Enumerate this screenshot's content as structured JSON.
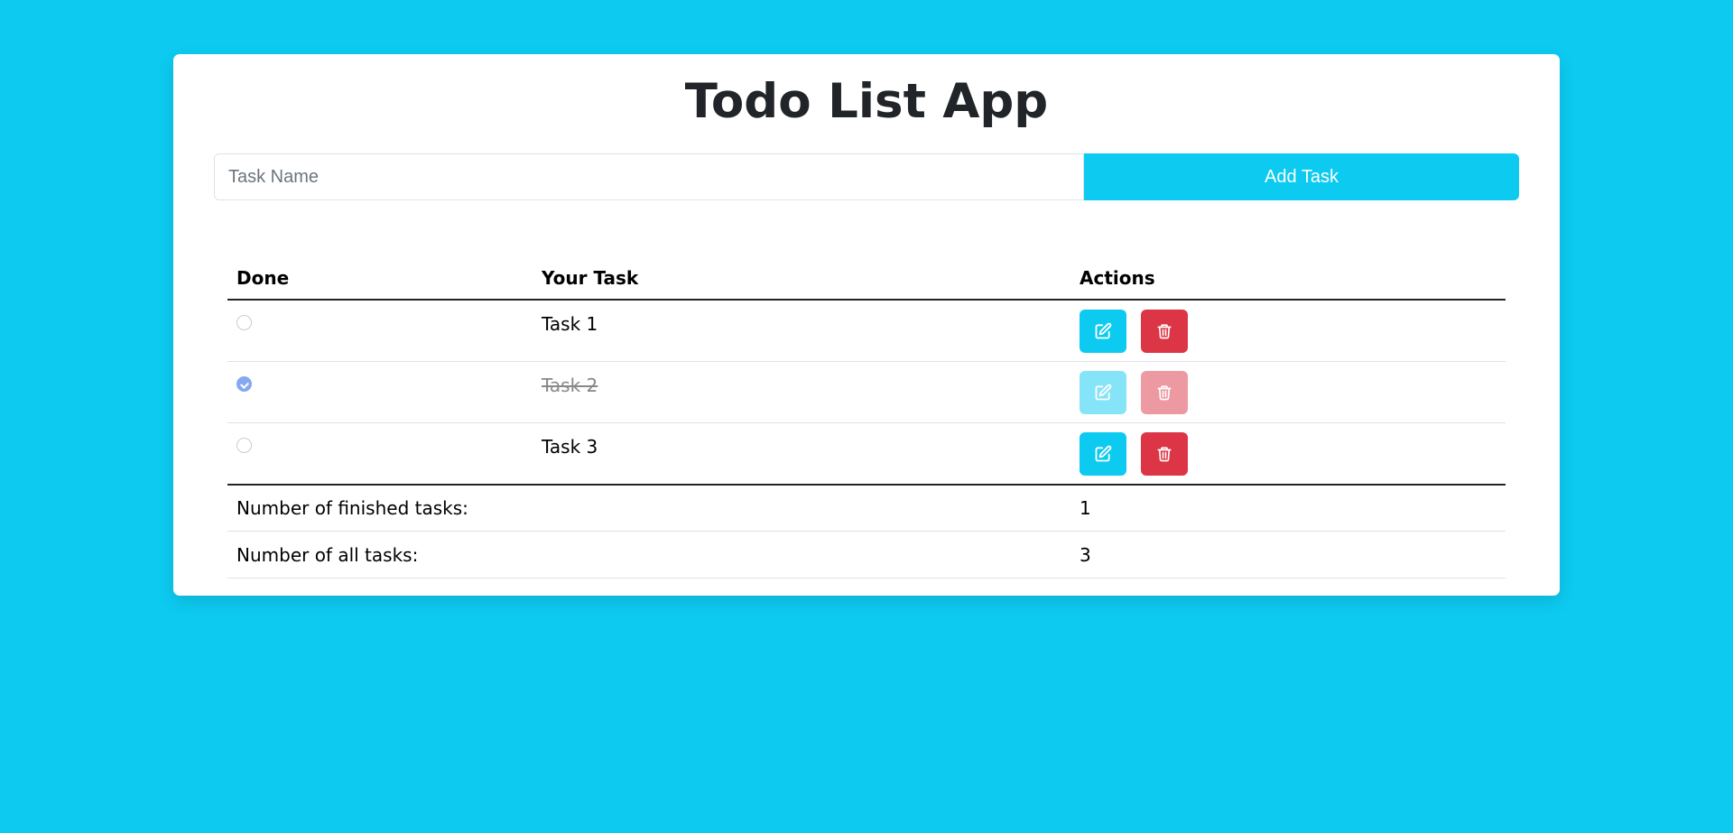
{
  "app": {
    "title": "Todo List App",
    "background_color": "#0dcaf0"
  },
  "form": {
    "input_value": "",
    "input_placeholder": "Task Name",
    "add_button_label": "Add Task"
  },
  "table": {
    "headers": {
      "done": "Done",
      "task": "Your Task",
      "actions": "Actions"
    },
    "rows": [
      {
        "task": "Task 1",
        "done": false
      },
      {
        "task": "Task 2",
        "done": true
      },
      {
        "task": "Task 3",
        "done": false
      }
    ],
    "action_icons": {
      "edit": "edit-icon",
      "delete": "trash-icon"
    },
    "colors": {
      "edit": "#0dcaf0",
      "delete": "#dc3545"
    }
  },
  "summary": {
    "finished_label": "Number of finished tasks:",
    "finished_value": "1",
    "all_label": "Number of all tasks:",
    "all_value": "3"
  }
}
